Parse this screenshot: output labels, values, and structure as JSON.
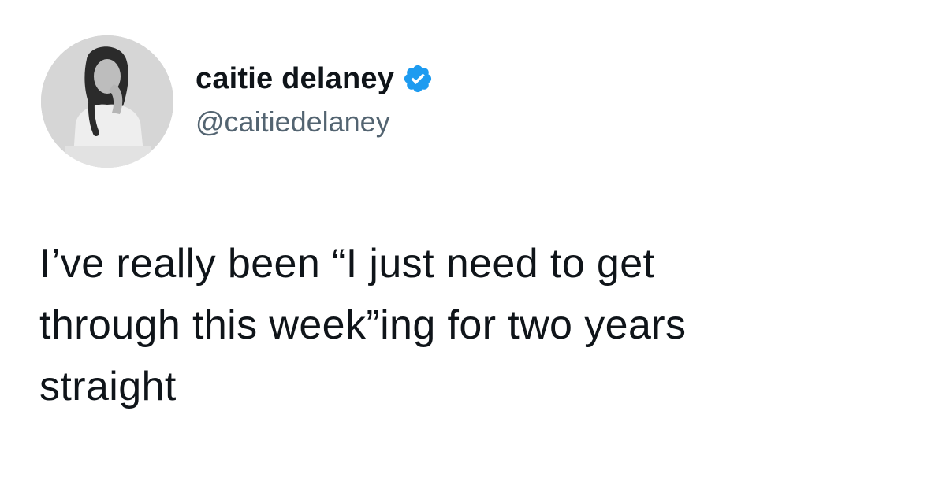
{
  "tweet": {
    "author": {
      "display_name": "caitie delaney",
      "handle": "@caitiedelaney",
      "verified": true,
      "verified_icon": "verified-badge-icon",
      "verified_color": "#1d9bf0"
    },
    "text": "I’ve really been “I just need to get\nthrough this week”ing for two years\nstraight"
  },
  "colors": {
    "text_primary": "#0f1419",
    "text_secondary": "#536471",
    "background": "#ffffff"
  }
}
